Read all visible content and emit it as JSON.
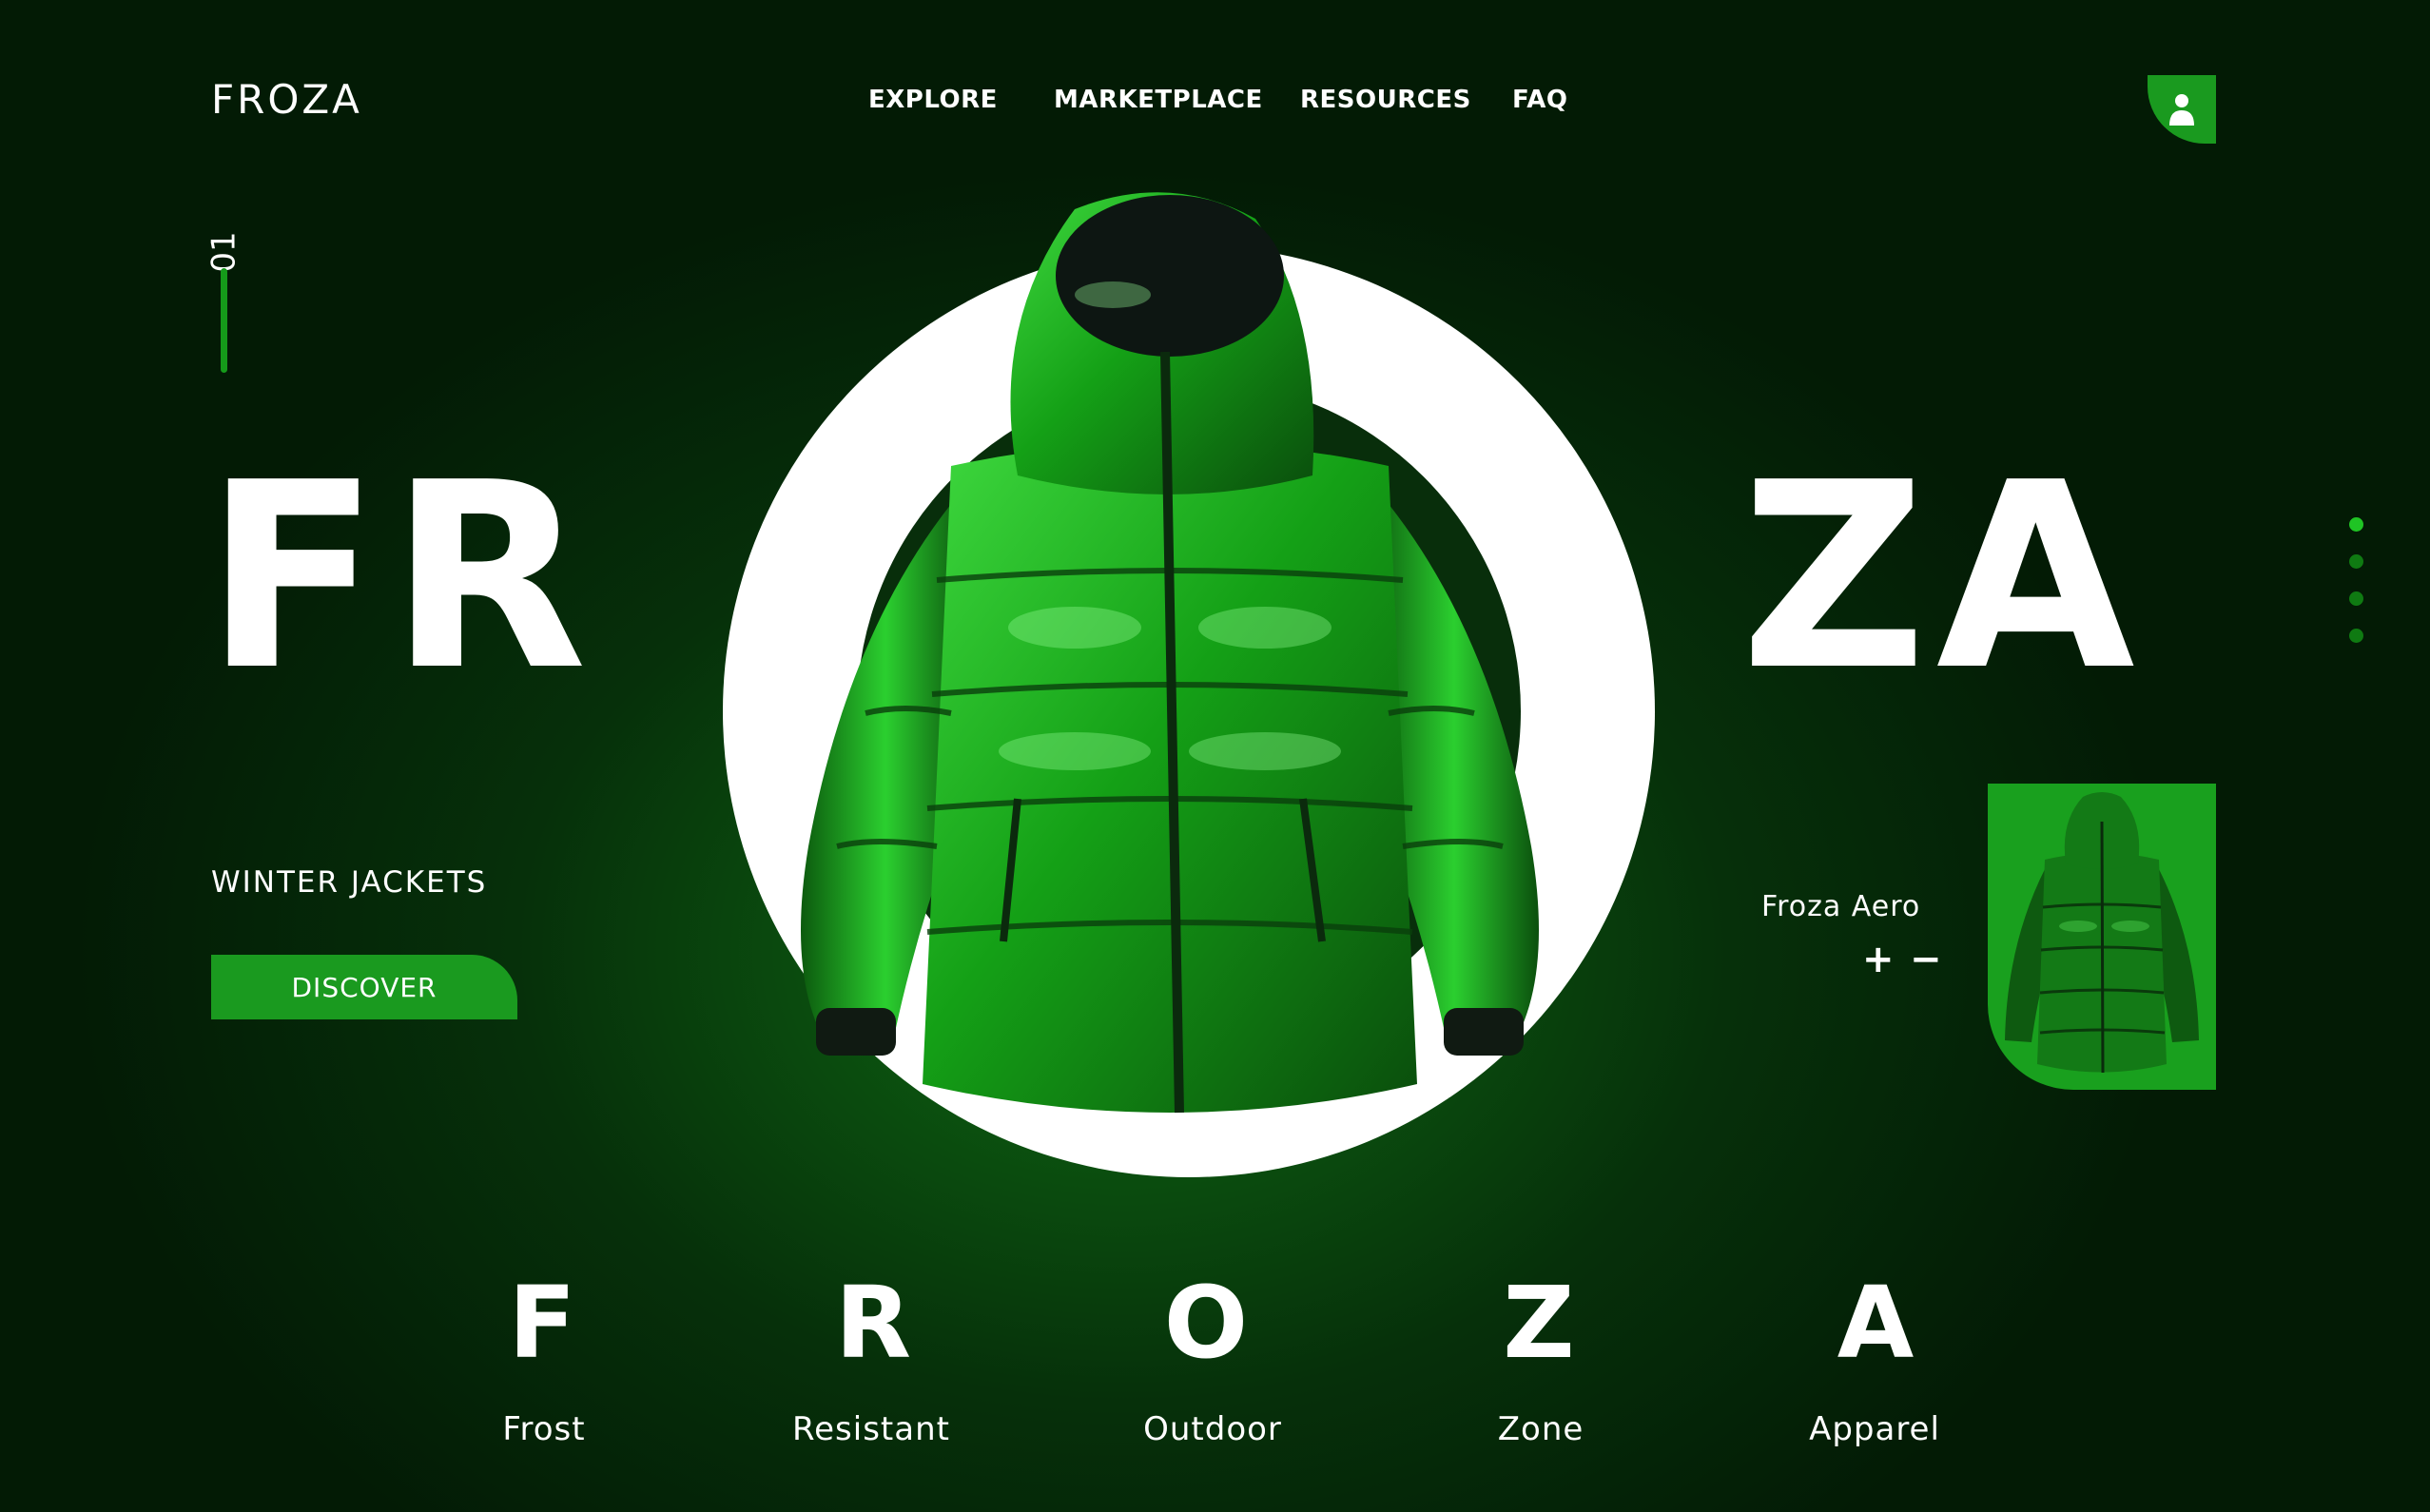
{
  "brand": {
    "logo": "FROZA"
  },
  "nav": {
    "items": [
      "EXPLORE",
      "MARKETPLACE",
      "RESOURCES",
      "FAQ"
    ]
  },
  "slide": {
    "number": "01"
  },
  "hero": {
    "title_left": "FR",
    "title_right": "ZA",
    "subtitle": "WINTER JACKETS",
    "cta_label": "DISCOVER"
  },
  "product": {
    "name": "Froza Aero",
    "plus": "+",
    "minus": "−"
  },
  "acronym": {
    "letters": [
      "F",
      "R",
      "O",
      "Z",
      "A"
    ],
    "words": [
      "Frost",
      "Resistant",
      "Outdoor",
      "Zone",
      "Apparel"
    ]
  },
  "colors": {
    "accent": "#1a9a1f",
    "background": "#031b05",
    "text": "#ffffff"
  },
  "pager": {
    "count": 4,
    "active": 0
  }
}
